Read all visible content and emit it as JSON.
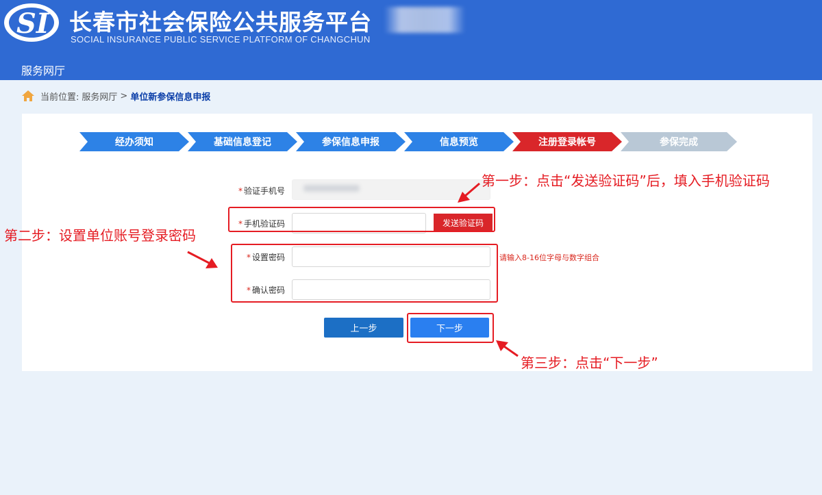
{
  "header": {
    "title": "长春市社会保险公共服务平台",
    "subtitle": "SOCIAL INSURANCE PUBLIC SERVICE PLATFORM OF CHANGCHUN",
    "logo_text": "SI",
    "nav_hall": "服务网厅"
  },
  "breadcrumb": {
    "prefix": "当前位置:",
    "parent": "服务网厅",
    "separator": ">",
    "current": "单位新参保信息申报"
  },
  "steps": [
    {
      "label": "经办须知",
      "state": "done"
    },
    {
      "label": "基础信息登记",
      "state": "done"
    },
    {
      "label": "参保信息申报",
      "state": "done"
    },
    {
      "label": "信息预览",
      "state": "done"
    },
    {
      "label": "注册登录帐号",
      "state": "active"
    },
    {
      "label": "参保完成",
      "state": "pending"
    }
  ],
  "colors": {
    "header_bg": "#2f6ad3",
    "step_done": "#2d82e6",
    "step_active": "#d9262a",
    "step_pending": "#b9c8d6",
    "annotation_red": "#e51c23",
    "page_bg": "#eaf2fa"
  },
  "form": {
    "phone_label": "验证手机号",
    "sms_label": "手机验证码",
    "send_code_button": "发送验证码",
    "password_label": "设置密码",
    "confirm_label": "确认密码",
    "password_hint": "请输入8-16位字母与数字组合",
    "required_mark": "*",
    "prev_button": "上一步",
    "next_button": "下一步"
  },
  "annotations": {
    "step1": "第一步：点击“发送验证码”后，填入手机验证码",
    "step2": "第二步：设置单位账号登录密码",
    "step3": "第三步：点击“下一步”"
  }
}
